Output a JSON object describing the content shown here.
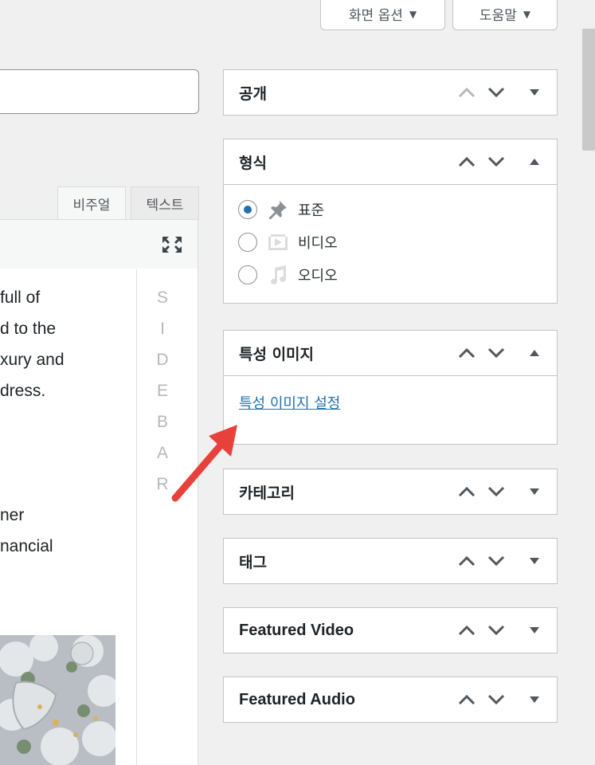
{
  "header": {
    "screen_options": "화면 옵션",
    "help": "도움말"
  },
  "editor": {
    "tab_visual": "비주얼",
    "tab_text": "텍스트",
    "content_lines": [
      " full of",
      "d to the",
      "xury and",
      " dress.",
      "",
      "",
      "",
      "ner",
      "nancial"
    ],
    "sidebar_letters": [
      "S",
      "I",
      "D",
      "E",
      "B",
      "A",
      "R"
    ]
  },
  "boxes": {
    "publish": {
      "title": "공개"
    },
    "format": {
      "title": "형식",
      "options": [
        {
          "label": "표준",
          "icon": "pin-icon",
          "checked": true
        },
        {
          "label": "비디오",
          "icon": "video-icon",
          "checked": false
        },
        {
          "label": "오디오",
          "icon": "audio-icon",
          "checked": false
        }
      ]
    },
    "featured_image": {
      "title": "특성 이미지",
      "link": "특성 이미지 설정"
    },
    "categories": {
      "title": "카테고리"
    },
    "tags": {
      "title": "태그"
    },
    "featured_video": {
      "title": "Featured Video"
    },
    "featured_audio": {
      "title": "Featured Audio"
    }
  },
  "colors": {
    "accent": "#2271b1",
    "annotation_arrow": "#e8413b"
  }
}
